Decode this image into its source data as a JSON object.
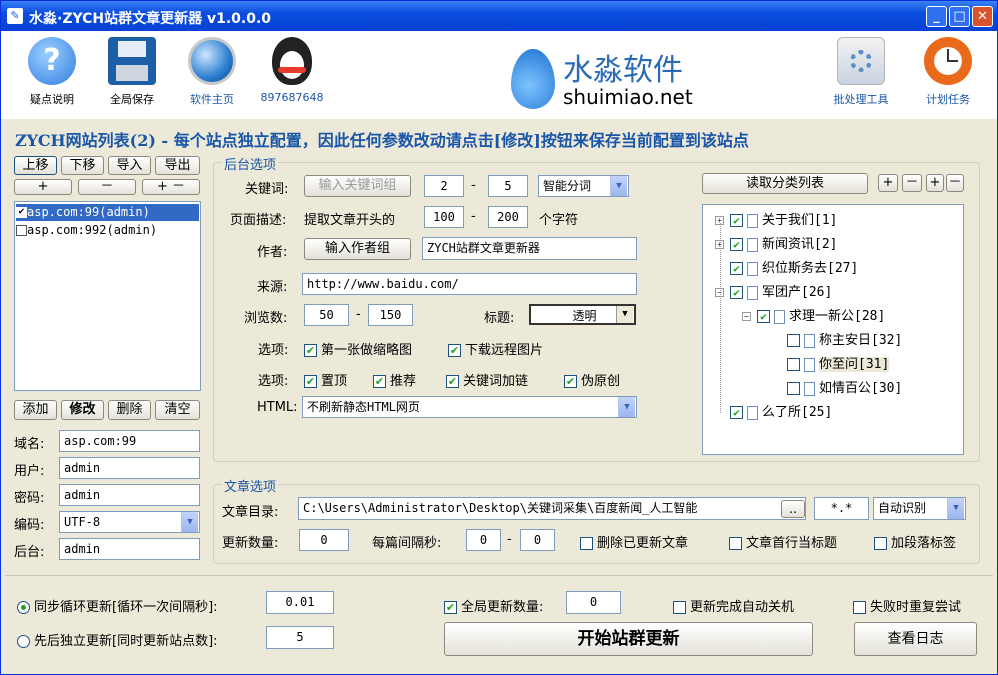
{
  "app": {
    "title": "水淼·ZYCH站群文章更新器 v1.0.0.0",
    "controls": {
      "min": "_",
      "max": "□",
      "close": "✕"
    }
  },
  "toolbar": {
    "left": [
      {
        "label": "疑点说明",
        "icon": "help-icon",
        "color": "#2f7de0"
      },
      {
        "label": "全局保存",
        "icon": "floppy-save-icon",
        "color": "#1c5fa6"
      },
      {
        "label": "软件主页",
        "icon": "globe-icon",
        "color": "#2a7fd0"
      },
      {
        "label": "897687648",
        "icon": "qq-penguin-icon",
        "color": "#222222"
      }
    ],
    "right": [
      {
        "label": "批处理工具",
        "icon": "gear-icon",
        "color": "#5e8fc4"
      },
      {
        "label": "计划任务",
        "icon": "clock-icon",
        "color": "#e96a1a"
      }
    ],
    "logo": {
      "cn": "水淼软件",
      "en": "shuimiao.net"
    }
  },
  "heading": "ZYCH网站列表(2) - 每个站点独立配置，因此任何参数改动请点击[修改]按钮来保存当前配置到该站点",
  "sites": {
    "buttons": [
      "上移",
      "下移",
      "导入",
      "导出"
    ],
    "small": [
      "+",
      "－",
      "+ －"
    ],
    "items": [
      {
        "label": "asp.com:99(admin)",
        "checked": true,
        "selected": true
      },
      {
        "label": "asp.com:992(admin)",
        "checked": false,
        "selected": false
      }
    ],
    "actions": [
      "添加",
      "修改",
      "删除",
      "清空"
    ],
    "fields": [
      {
        "label": "域名:",
        "value": "asp.com:99"
      },
      {
        "label": "用户:",
        "value": "admin"
      },
      {
        "label": "密码:",
        "value": "admin"
      },
      {
        "label": "编码:",
        "value": "UTF-8"
      },
      {
        "label": "后台:",
        "value": "admin"
      }
    ]
  },
  "backend": {
    "title": "后台选项",
    "keyword": {
      "label": "关键词:",
      "button": "输入关键词组",
      "min": "2",
      "max": "5",
      "split": "智能分词"
    },
    "desc": {
      "label": "页面描述:",
      "text": "提取文章开头的",
      "min": "100",
      "max": "200",
      "unit": "个字符"
    },
    "author": {
      "label": "作者:",
      "button": "输入作者组",
      "value": "ZYCH站群文章更新器"
    },
    "source": {
      "label": "来源:",
      "value": "http://www.baidu.com/"
    },
    "views": {
      "label": "浏览数:",
      "min": "50",
      "max": "150"
    },
    "titlesel": {
      "label": "标题:",
      "value": "透明"
    },
    "opt1": {
      "label": "选项:",
      "a": "第一张做缩略图",
      "b": "下载远程图片"
    },
    "opt2": {
      "label": "选项:",
      "a": "置顶",
      "b": "推荐",
      "c": "关键词加链",
      "d": "伪原创"
    },
    "html": {
      "label": "HTML:",
      "value": "不刷新静态HTML网页"
    },
    "dash": "-"
  },
  "category": {
    "button": "读取分类列表",
    "small": [
      "+",
      "－",
      "+",
      "－"
    ],
    "nodes": [
      {
        "label": "关于我们[1]"
      },
      {
        "label": "新闻资讯[2]"
      },
      {
        "label": "织位斯务去[27]"
      },
      {
        "label": "军团产[26]"
      },
      {
        "label": "求理一新公[28]"
      },
      {
        "label": "称主安日[32]"
      },
      {
        "label": "你至问[31]"
      },
      {
        "label": "如情百公[30]"
      },
      {
        "label": "么了所[25]"
      }
    ]
  },
  "article": {
    "title": "文章选项",
    "dir": {
      "label": "文章目录:",
      "value": "C:\\Users\\Administrator\\Desktop\\关键词采集\\百度新闻_人工智能",
      "browse": "..",
      "ext": "*.*",
      "enc": "自动识别"
    },
    "count": {
      "label": "更新数量:",
      "value": "0"
    },
    "interval": {
      "label": "每篇间隔秒:",
      "min": "0",
      "max": "0"
    },
    "c1": "删除已更新文章",
    "c2": "文章首行当标题",
    "c3": "加段落标签"
  },
  "bottom": {
    "r1": {
      "label": "同步循环更新[循环一次间隔秒]:",
      "value": "0.01"
    },
    "r2": {
      "label": "先后独立更新[同时更新站点数]:",
      "value": "5"
    },
    "global": {
      "label": "全局更新数量:",
      "value": "0"
    },
    "shutdown": "更新完成自动关机",
    "retry": "失败时重复尝试",
    "start": "开始站群更新",
    "log": "查看日志"
  }
}
